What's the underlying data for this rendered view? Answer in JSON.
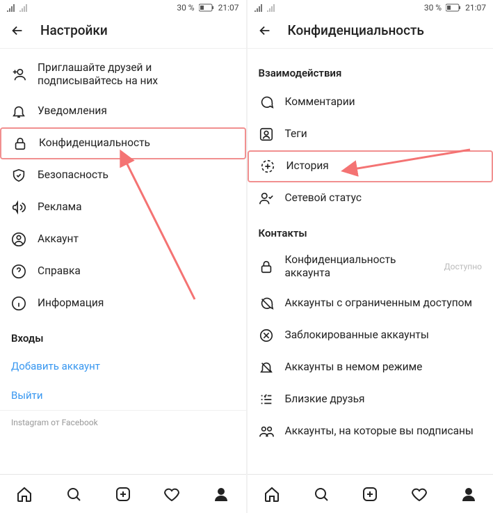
{
  "statusbar": {
    "battery_text": "30 %",
    "time": "21:07"
  },
  "left_screen": {
    "header_title": "Настройки",
    "items": [
      {
        "label": "Приглашайте друзей и подписывайтесь на них",
        "icon": "add-user"
      },
      {
        "label": "Уведомления",
        "icon": "bell"
      },
      {
        "label": "Конфиденциальность",
        "icon": "lock",
        "highlight": true
      },
      {
        "label": "Безопасность",
        "icon": "shield"
      },
      {
        "label": "Реклама",
        "icon": "megaphone"
      },
      {
        "label": "Аккаунт",
        "icon": "user-circle"
      },
      {
        "label": "Справка",
        "icon": "help"
      },
      {
        "label": "Информация",
        "icon": "info"
      }
    ],
    "logins_title": "Входы",
    "add_account": "Добавить аккаунт",
    "logout": "Выйти",
    "footer": "Instagram от Facebook"
  },
  "right_screen": {
    "header_title": "Конфиденциальность",
    "section1_title": "Взаимодействия",
    "section1_items": [
      {
        "label": "Комментарии",
        "icon": "comment"
      },
      {
        "label": "Теги",
        "icon": "tag-user"
      },
      {
        "label": "История",
        "icon": "story",
        "highlight": true
      },
      {
        "label": "Сетевой статус",
        "icon": "status"
      }
    ],
    "section2_title": "Контакты",
    "section2_items": [
      {
        "label": "Конфиденциальность аккаунта",
        "icon": "lock",
        "trail": "Доступно"
      },
      {
        "label": "Аккаунты с ограниченным доступом",
        "icon": "no-comment"
      },
      {
        "label": "Заблокированные аккаунты",
        "icon": "blocked"
      },
      {
        "label": "Аккаунты в немом режиме",
        "icon": "muted"
      },
      {
        "label": "Близкие друзья",
        "icon": "close-friends"
      },
      {
        "label": "Аккаунты, на которые вы подписаны",
        "icon": "following"
      }
    ]
  }
}
